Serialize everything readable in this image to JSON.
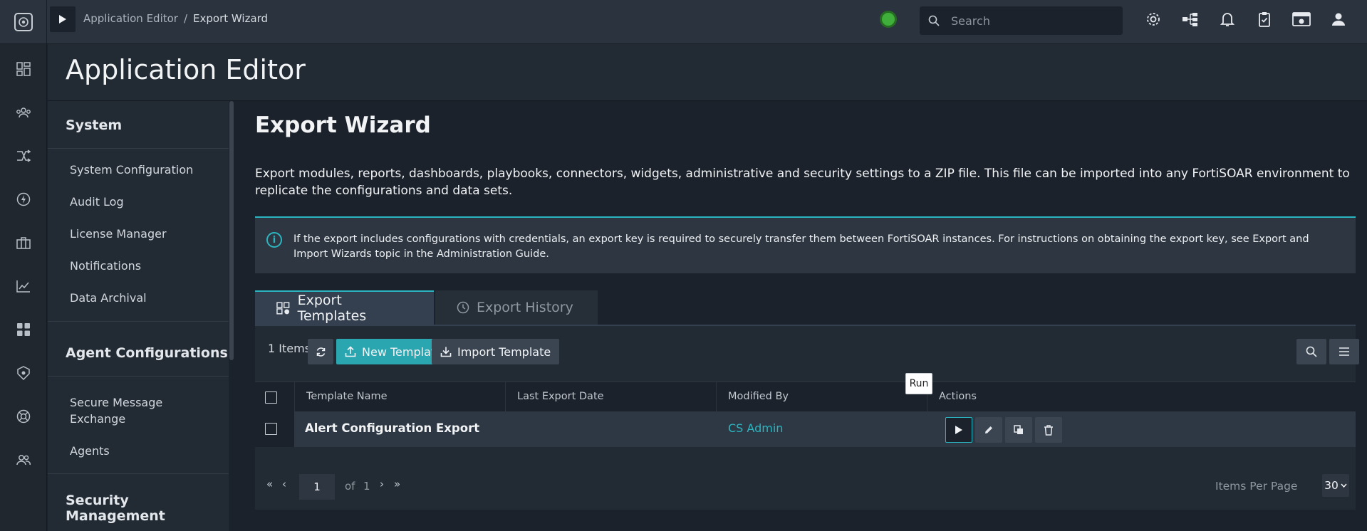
{
  "topbar": {
    "breadcrumb": [
      "Application Editor",
      "Export Wizard"
    ],
    "breadcrumb_sep": "/",
    "search_placeholder": "Search",
    "icons": [
      "settings-icon",
      "hierarchy-icon",
      "bell-icon",
      "clipboard-check-icon",
      "browser-settings-icon",
      "user-icon"
    ]
  },
  "leftnav": {
    "icons": [
      "dashboard-icon",
      "people-group-icon",
      "shuffle-icon",
      "lightning-icon",
      "briefcase-icon",
      "chart-line-icon",
      "apps-grid-icon",
      "shield-alert-icon",
      "life-ring-icon",
      "users-icon"
    ]
  },
  "page": {
    "title": "Application Editor"
  },
  "sidebar": {
    "sections": [
      {
        "title": "System",
        "items": [
          "System Configuration",
          "Audit Log",
          "License Manager",
          "Notifications",
          "Data Archival"
        ]
      },
      {
        "title": "Agent Configurations",
        "items": [
          "Secure Message Exchange",
          "Agents"
        ]
      },
      {
        "title": "Security Management",
        "items": []
      }
    ]
  },
  "main": {
    "title": "Export Wizard",
    "description": "Export modules, reports, dashboards, playbooks, connectors, widgets, administrative and security settings to a ZIP file. This file can be imported into any FortiSOAR environment to replicate the configurations and data sets.",
    "info": "If the export includes configurations with credentials, an export key is required to securely transfer them between FortiSOAR instances. For instructions on obtaining the export key, see Export and Import Wizards topic in the Administration Guide.",
    "tabs": [
      {
        "label": "Export Templates",
        "active": true
      },
      {
        "label": "Export History",
        "active": false
      }
    ]
  },
  "grid": {
    "items_count": "1 Items",
    "new_template": "New Template",
    "import_template": "Import Template",
    "columns": [
      "Template Name",
      "Last Export Date",
      "Modified By",
      "Actions"
    ],
    "rows": [
      {
        "name": "Alert Configuration Export",
        "last_export": "",
        "modified_by": "CS Admin"
      }
    ],
    "tooltip": "Run",
    "pager": {
      "page": "1",
      "of_label": "of",
      "total_pages": "1",
      "ipp_label": "Items Per Page",
      "ipp_value": "30"
    }
  },
  "colors": {
    "accent": "#2bb5c0",
    "topbar": "#2b333e",
    "background": "#1b222b",
    "status": "#3fae3a"
  }
}
